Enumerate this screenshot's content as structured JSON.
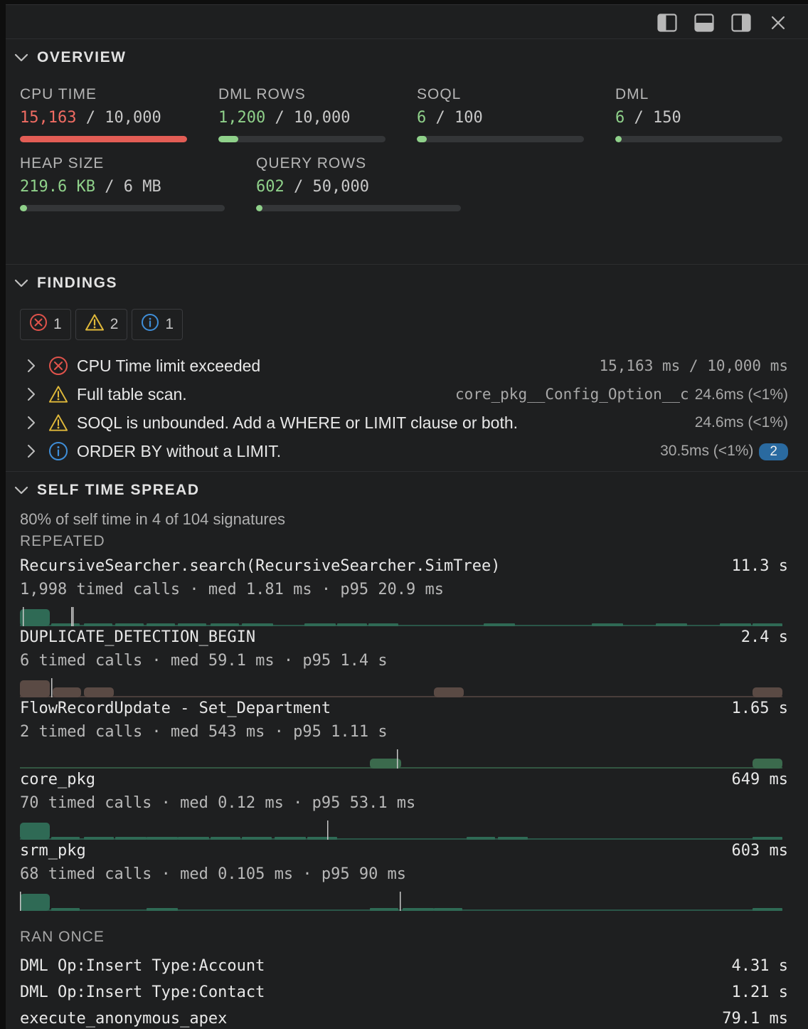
{
  "overview": {
    "title": "OVERVIEW",
    "metrics": [
      {
        "label": "CPU TIME",
        "used": "15,163",
        "limit": "10,000",
        "fraction": 1.0,
        "status": "bad"
      },
      {
        "label": "DML ROWS",
        "used": "1,200",
        "limit": "10,000",
        "fraction": 0.12,
        "status": "ok"
      },
      {
        "label": "SOQL",
        "used": "6",
        "limit": "100",
        "fraction": 0.06,
        "status": "ok"
      },
      {
        "label": "DML",
        "used": "6",
        "limit": "150",
        "fraction": 0.04,
        "status": "ok"
      },
      {
        "label": "HEAP SIZE",
        "used": "219.6 KB",
        "limit": "6 MB",
        "fraction": 0.036,
        "status": "ok"
      },
      {
        "label": "QUERY ROWS",
        "used": "602",
        "limit": "50,000",
        "fraction": 0.012,
        "status": "ok"
      }
    ],
    "slash": "/"
  },
  "findings": {
    "title": "FINDINGS",
    "counts": {
      "error": "1",
      "warning": "2",
      "info": "1"
    },
    "items": [
      {
        "severity": "error",
        "text": "CPU Time limit exceeded",
        "meta": "15,163 ms / 10,000 ms",
        "meta_mono": true
      },
      {
        "severity": "warning",
        "text": "Full table scan.",
        "meta_object": "core_pkg__Config_Option__c",
        "meta": "24.6ms (<1%)"
      },
      {
        "severity": "warning",
        "text": "SOQL is unbounded. Add a WHERE or LIMIT clause or both.",
        "meta": "24.6ms (<1%)"
      },
      {
        "severity": "info",
        "text": "ORDER BY without a LIMIT.",
        "meta": "30.5ms (<1%)",
        "count": "2"
      }
    ]
  },
  "self_time": {
    "title": "SELF TIME SPREAD",
    "summary": "80% of self time in 4 of 104 signatures",
    "repeated_label": "REPEATED",
    "repeated": [
      {
        "name": "RecursiveSearcher.search(RecursiveSearcher.SimTree)",
        "total": "11.3 s",
        "stats": "1,998 timed calls · med 1.81 ms · p95 20.9 ms",
        "color": "#2f6a55"
      },
      {
        "name": "DUPLICATE_DETECTION_BEGIN",
        "total": "2.4 s",
        "stats": "6 timed calls · med 59.1 ms · p95 1.4 s",
        "color": "#5a4a44"
      },
      {
        "name": "FlowRecordUpdate - Set_Department",
        "total": "1.65 s",
        "stats": "2 timed calls · med 543 ms · p95 1.11 s",
        "color": "#3b6a4d"
      },
      {
        "name": "core_pkg",
        "total": "649 ms",
        "stats": "70 timed calls · med 0.12 ms · p95 53.1 ms",
        "color": "#2f6a55"
      },
      {
        "name": "srm_pkg",
        "total": "603 ms",
        "stats": "68 timed calls · med 0.105 ms · p95 90 ms",
        "color": "#2f6a55"
      }
    ],
    "once_label": "RAN ONCE",
    "once": [
      {
        "name": "DML Op:Insert Type:Account",
        "total": "4.31 s"
      },
      {
        "name": "DML Op:Insert Type:Contact",
        "total": "1.21 s"
      },
      {
        "name": "execute_anonymous_apex",
        "total": "79.1 ms"
      }
    ]
  },
  "toolbar": {
    "icons": [
      "panel-left-icon",
      "panel-bottom-icon",
      "panel-right-icon",
      "close-icon"
    ]
  },
  "colors": {
    "bad": "#e35d55",
    "ok": "#8fd18a",
    "error": "#e0534b",
    "warning": "#e0b93a",
    "info": "#3f8ed8"
  }
}
